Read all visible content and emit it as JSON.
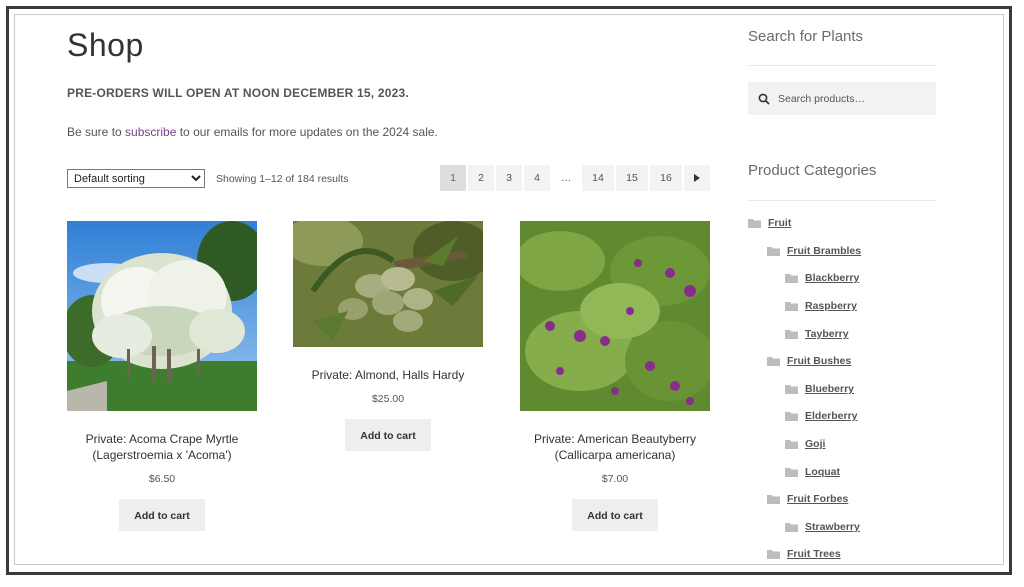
{
  "page": {
    "title": "Shop",
    "notice": "PRE-ORDERS WILL OPEN AT NOON DECEMBER 15, 2023.",
    "subscribe_prefix": "Be sure to ",
    "subscribe_link": "subscribe",
    "subscribe_suffix": " to our emails for more updates on the 2024 sale."
  },
  "toolbar": {
    "sort_selected": "Default sorting",
    "result_count": "Showing 1–12 of 184 results"
  },
  "pagination": {
    "pages": [
      "1",
      "2",
      "3",
      "4",
      "…",
      "14",
      "15",
      "16"
    ],
    "current": "1",
    "next_icon": "triangle-right-icon"
  },
  "products": [
    {
      "name": "Private: Acoma Crape Myrtle (Lagerstroemia x 'Acoma')",
      "price": "$6.50",
      "button": "Add to cart"
    },
    {
      "name": "Private: Almond, Halls Hardy",
      "price": "$25.00",
      "button": "Add to cart"
    },
    {
      "name": "Private: American Beautyberry (Callicarpa americana)",
      "price": "$7.00",
      "button": "Add to cart"
    }
  ],
  "sidebar": {
    "search_heading": "Search for Plants",
    "search_placeholder": "Search products…",
    "categories_heading": "Product Categories",
    "categories": [
      {
        "label": "Fruit",
        "level": 0
      },
      {
        "label": "Fruit Brambles",
        "level": 1
      },
      {
        "label": "Blackberry",
        "level": 2
      },
      {
        "label": "Raspberry",
        "level": 2
      },
      {
        "label": "Tayberry",
        "level": 2
      },
      {
        "label": "Fruit Bushes",
        "level": 1
      },
      {
        "label": "Blueberry",
        "level": 2
      },
      {
        "label": "Elderberry",
        "level": 2
      },
      {
        "label": "Goji",
        "level": 2
      },
      {
        "label": "Loquat",
        "level": 2
      },
      {
        "label": "Fruit Forbes",
        "level": 1
      },
      {
        "label": "Strawberry",
        "level": 2
      },
      {
        "label": "Fruit Trees",
        "level": 1
      }
    ]
  },
  "colors": {
    "link": "#7a3f86",
    "button_bg": "#eeeeee",
    "current_page_bg": "#dedede"
  }
}
